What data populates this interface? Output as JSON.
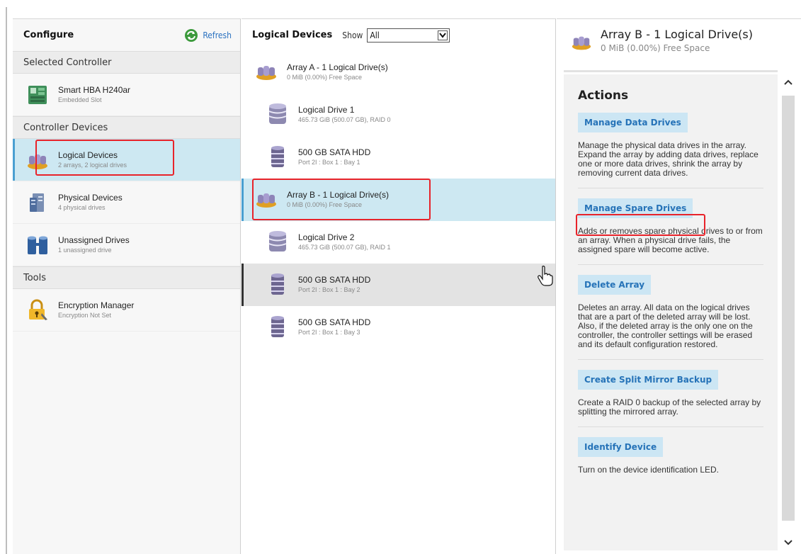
{
  "configure": {
    "title": "Configure",
    "refresh_label": "Refresh",
    "sections": {
      "selected_controller": "Selected Controller",
      "controller_devices": "Controller Devices",
      "tools": "Tools"
    },
    "controller": {
      "title": "Smart HBA H240ar",
      "subtitle": "Embedded Slot",
      "icon": "controller-card-icon"
    },
    "controller_devices": [
      {
        "title": "Logical Devices",
        "subtitle": "2 arrays, 2 logical drives",
        "icon": "logical-devices-icon",
        "selected": true
      },
      {
        "title": "Physical Devices",
        "subtitle": "4 physical drives",
        "icon": "physical-devices-icon"
      },
      {
        "title": "Unassigned Drives",
        "subtitle": "1 unassigned drive",
        "icon": "unassigned-drives-icon"
      }
    ],
    "tools": [
      {
        "title": "Encryption Manager",
        "subtitle": "Encryption Not Set",
        "icon": "encryption-lock-icon"
      }
    ]
  },
  "devices": {
    "title": "Logical Devices",
    "show_label": "Show",
    "show_value": "All",
    "items": [
      {
        "title": "Array A - 1 Logical Drive(s)",
        "subtitle": "0 MiB (0.00%) Free Space",
        "kind": "array"
      },
      {
        "title": "Logical Drive 1",
        "subtitle": "465.73 GiB (500.07 GB), RAID 0",
        "kind": "logical-drive"
      },
      {
        "title": "500 GB SATA HDD",
        "subtitle": "Port 2I : Box 1 : Bay 1",
        "kind": "hdd"
      },
      {
        "title": "Array B - 1 Logical Drive(s)",
        "subtitle": "0 MiB (0.00%) Free Space",
        "kind": "array",
        "selected": true
      },
      {
        "title": "Logical Drive 2",
        "subtitle": "465.73 GiB (500.07 GB), RAID 1",
        "kind": "logical-drive"
      },
      {
        "title": "500 GB SATA HDD",
        "subtitle": "Port 2I : Box 1 : Bay 2",
        "kind": "hdd",
        "hover": true
      },
      {
        "title": "500 GB SATA HDD",
        "subtitle": "Port 2I : Box 1 : Bay 3",
        "kind": "hdd"
      }
    ]
  },
  "actions_panel": {
    "title": "Array B - 1 Logical Drive(s)",
    "subtitle": "0 MiB (0.00%) Free Space",
    "heading": "Actions",
    "actions": [
      {
        "label": "Manage Data Drives",
        "desc": "Manage the physical data drives in the array. Expand the array by adding data drives, replace one or more data drives, shrink the array by removing current data drives."
      },
      {
        "label": "Manage Spare Drives",
        "desc": "Adds or removes spare physical drives to or from an array. When a physical drive fails, the assigned spare will become active."
      },
      {
        "label": "Delete Array",
        "desc": "Deletes an array. All data on the logical drives that are a part of the deleted array will be lost. Also, if the deleted array is the only one on the controller, the controller settings will be erased and its default configuration restored."
      },
      {
        "label": "Create Split Mirror Backup",
        "desc": "Create a RAID 0 backup of the selected array by splitting the mirrored array."
      },
      {
        "label": "Identify Device",
        "desc": "Turn on the device identification LED."
      }
    ]
  },
  "colors": {
    "accent": "#2673b8",
    "selected_bg": "#cde8f2",
    "highlight": "#e8232a",
    "action_button_bg": "#cce6f4"
  }
}
